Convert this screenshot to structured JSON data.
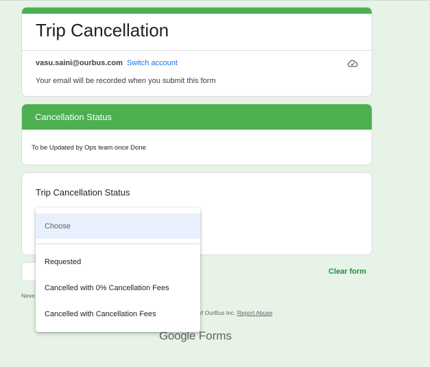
{
  "form": {
    "title": "Trip Cancellation",
    "account_email": "vasu.saini@ourbus.com",
    "switch_account": "Switch account",
    "email_note": "Your email will be recorded when you submit this form"
  },
  "section": {
    "title": "Cancellation Status",
    "description": "To be Updated by Ops team once Done"
  },
  "question": {
    "title": "Trip Cancellation Status",
    "dropdown_selected": "Choose",
    "options": [
      "Requested",
      "Cancelled with 0% Cancellation Fees",
      "Cancelled with Cancellation Fees"
    ]
  },
  "actions": {
    "clear_form": "Clear form"
  },
  "footer": {
    "never_text": "Neve",
    "owner_text": "of OurBus Inc.",
    "report_abuse": "Report Abuse",
    "brand_google": "Google",
    "brand_forms": "Forms"
  },
  "colors": {
    "accent": "#4caf50",
    "background": "#e6f3e6",
    "link": "#1a73e8"
  },
  "icons": {
    "cloud": "cloud-saved-icon"
  }
}
